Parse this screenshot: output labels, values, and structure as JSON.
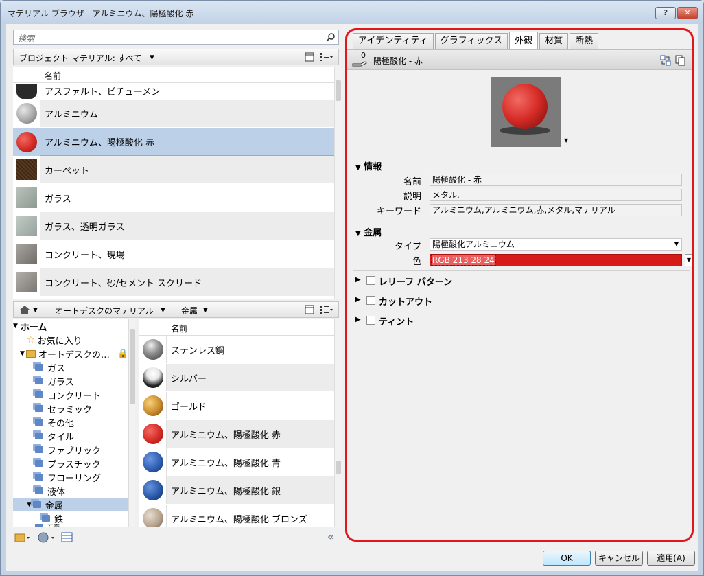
{
  "window": {
    "title": "マテリアル ブラウザ - アルミニウム、陽極酸化 赤",
    "help_label": "?",
    "close_label": "✕"
  },
  "search": {
    "placeholder": "検索"
  },
  "project_bar": {
    "label": "プロジェクト マテリアル: すべて"
  },
  "project_list": {
    "column": "名前",
    "rows": [
      {
        "label": "アスファルト、ビチューメン",
        "thumb": "#2a2a2a"
      },
      {
        "label": "アルミニウム",
        "thumb": "#a8a8a8"
      },
      {
        "label": "アルミニウム、陽極酸化 赤",
        "thumb": "#d52a25"
      },
      {
        "label": "カーペット",
        "thumb": "#5a3b22"
      },
      {
        "label": "ガラス",
        "thumb": "#9aa7a0"
      },
      {
        "label": "ガラス、透明ガラス",
        "thumb": "#a3aea7"
      },
      {
        "label": "コンクリート、現場",
        "thumb": "#8a8682"
      },
      {
        "label": "コンクリート、砂/セメント スクリード",
        "thumb": "#999591"
      }
    ]
  },
  "library_bar": {
    "home": "⌂",
    "crumb1": "オートデスクのマテリアル",
    "crumb2": "金属"
  },
  "tree": {
    "home": "ホーム",
    "favorites": "お気に入り",
    "autodesk": "オートデスクの…",
    "items": [
      "ガス",
      "ガラス",
      "コンクリート",
      "セラミック",
      "その他",
      "タイル",
      "ファブリック",
      "プラスチック",
      "フローリング",
      "液体",
      "金属",
      "鉄",
      "石膏"
    ]
  },
  "library_list": {
    "column": "名前",
    "rows": [
      {
        "label": "ステンレス鋼",
        "thumb": "#8c8c8c"
      },
      {
        "label": "シルバー",
        "thumb": "#e8e8e8"
      },
      {
        "label": "ゴールド",
        "thumb": "#c88a2c"
      },
      {
        "label": "アルミニウム、陽極酸化 赤",
        "thumb": "#d52a25"
      },
      {
        "label": "アルミニウム、陽極酸化 青",
        "thumb": "#2f5fb3"
      },
      {
        "label": "アルミニウム、陽極酸化 銀",
        "thumb": "#2a58a8"
      },
      {
        "label": "アルミニウム、陽極酸化 ブロンズ",
        "thumb": "#b8a590"
      }
    ]
  },
  "tabs": [
    "アイデンティティ",
    "グラフィックス",
    "外観",
    "材質",
    "断熱"
  ],
  "appearance": {
    "asset_count": "0",
    "asset_name": "陽極酸化 - 赤",
    "info_title": "情報",
    "name_label": "名前",
    "name_value": "陽極酸化 - 赤",
    "desc_label": "説明",
    "desc_value": "メタル.",
    "kw_label": "キーワード",
    "kw_value": "アルミニウム,アルミニウム,赤,メタル,マテリアル",
    "metal_title": "金属",
    "type_label": "タイプ",
    "type_value": "陽極酸化アルミニウム",
    "color_label": "色",
    "color_value": "RGB 213 28 24",
    "color_hex": "#d51c18",
    "relief_label": "レリーフ パターン",
    "cutout_label": "カットアウト",
    "tint_label": "ティント"
  },
  "footer": {
    "ok": "OK",
    "cancel": "キャンセル",
    "apply": "適用(A)"
  }
}
